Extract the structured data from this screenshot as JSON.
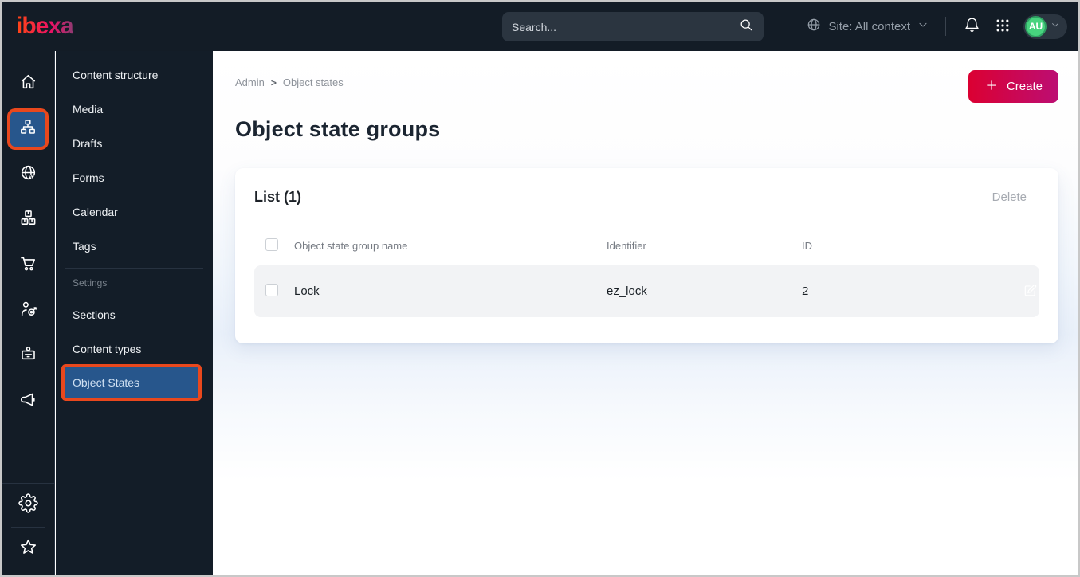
{
  "topbar": {
    "logo_text": "ibexa",
    "search_placeholder": "Search...",
    "site_context_label": "Site: All context",
    "avatar_initials": "AU",
    "icons": [
      "globe-icon",
      "chevron-down-icon",
      "bell-icon",
      "app-grid-icon",
      "search-icon"
    ]
  },
  "icon_rail": {
    "items": [
      {
        "name": "home-icon",
        "active": false
      },
      {
        "name": "content-structure-tree-icon",
        "active": true
      },
      {
        "name": "site-globe-cursor-icon",
        "active": false
      },
      {
        "name": "product-boxes-icon",
        "active": false
      },
      {
        "name": "commerce-cart-icon",
        "active": false
      },
      {
        "name": "customer-target-icon",
        "active": false
      },
      {
        "name": "id-badge-icon",
        "active": false
      },
      {
        "name": "megaphone-icon",
        "active": false
      }
    ],
    "bottom_items": [
      {
        "name": "gear-icon"
      },
      {
        "name": "star-icon"
      }
    ]
  },
  "sidebar": {
    "items": [
      {
        "label": "Content structure"
      },
      {
        "label": "Media"
      },
      {
        "label": "Drafts"
      },
      {
        "label": "Forms"
      },
      {
        "label": "Calendar"
      },
      {
        "label": "Tags"
      }
    ],
    "section_label": "Settings",
    "settings_items": [
      {
        "label": "Sections",
        "active": false
      },
      {
        "label": "Content types",
        "active": false
      },
      {
        "label": "Object States",
        "active": true
      }
    ]
  },
  "main": {
    "breadcrumb": {
      "root": "Admin",
      "current": "Object states"
    },
    "title": "Object state groups",
    "create_label": "Create",
    "list": {
      "title": "List (1)",
      "delete_label": "Delete",
      "columns": {
        "name": "Object state group name",
        "identifier": "Identifier",
        "id": "ID"
      },
      "rows": [
        {
          "name": "Lock",
          "identifier": "ez_lock",
          "id": "2"
        }
      ]
    }
  },
  "colors": {
    "topbar_bg": "#131c26",
    "active_blue": "#27568c",
    "annotation_orange": "#e9481d",
    "create_gradient_start": "#db0032",
    "create_gradient_end": "#bc0e73",
    "avatar_green": "#47d37e",
    "logo_gradient": [
      "#ff4713",
      "#ed1164",
      "#8f3a72"
    ],
    "row_bg": "#f2f3f5"
  }
}
